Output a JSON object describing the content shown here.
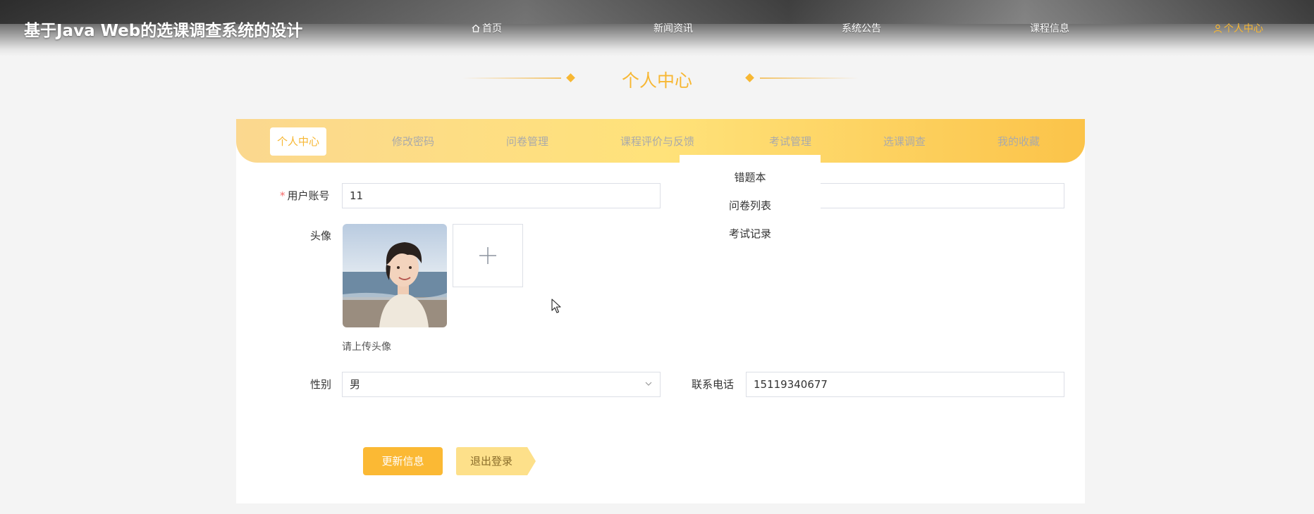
{
  "header": {
    "site_title": "基于Java Web的选课调查系统的设计",
    "nav": [
      {
        "label": "首页",
        "icon": "home-icon"
      },
      {
        "label": "新闻资讯"
      },
      {
        "label": "系统公告"
      },
      {
        "label": "课程信息"
      },
      {
        "label": "个人中心",
        "icon": "user-icon",
        "active": true
      }
    ]
  },
  "section": {
    "title": "个人中心"
  },
  "tabs": [
    {
      "label": "个人中心",
      "active": true
    },
    {
      "label": "修改密码"
    },
    {
      "label": "问卷管理"
    },
    {
      "label": "课程评价与反馈"
    },
    {
      "label": "考试管理"
    },
    {
      "label": "选课调查"
    },
    {
      "label": "我的收藏"
    }
  ],
  "dropdown": {
    "items": [
      "错题本",
      "问卷列表",
      "考试记录"
    ]
  },
  "form": {
    "account_label": "用户账号",
    "account_required_mark": "*",
    "account_value": "11",
    "avatar_label": "头像",
    "avatar_hint": "请上传头像",
    "gender_label": "性别",
    "gender_value": "男",
    "phone_label": "联系电话",
    "phone_value": "15119340677"
  },
  "buttons": {
    "update": "更新信息",
    "logout": "退出登录"
  },
  "colors": {
    "accent": "#f7b733",
    "button": "#fbb934",
    "tabbar_start": "#fbd88f",
    "tabbar_end": "#fbc349"
  }
}
